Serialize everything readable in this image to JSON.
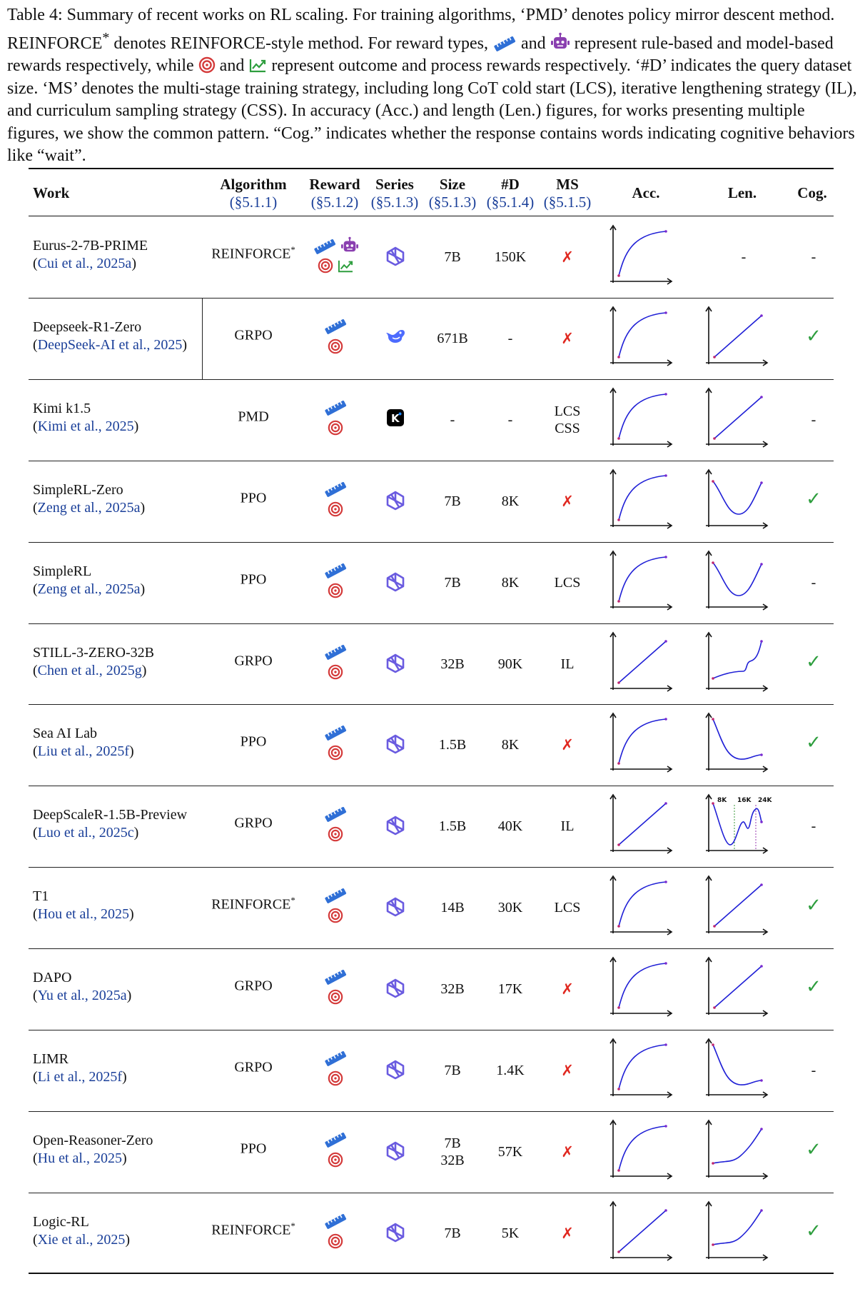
{
  "caption": {
    "p1": "Table 4: Summary of recent works on RL scaling. For training algorithms, ‘PMD’ denotes policy mirror descent method. REINFORCE",
    "p1_sup": "*",
    "p2": " denotes REINFORCE-style method. For reward types,",
    "p3": " and ",
    "p4": " represent rule-based and model-based rewards respectively, while ",
    "p5": " and ",
    "p6": " represent outcome and process rewards respectively. ‘#D’ indicates the query dataset size. ‘MS’ denotes the multi-stage training strategy, including long CoT cold start (LCS), iterative lengthening strategy (IL), and curriculum sampling strategy (CSS). In accuracy (Acc.) and length (Len.) figures, for works presenting multiple figures, we show the common pattern. “Cog.” indicates whether the response contains words indicating cognitive behaviors like “wait”."
  },
  "headers": {
    "work": "Work",
    "algorithm": "Algorithm",
    "algorithm_sec": "(§5.1.1)",
    "reward": "Reward",
    "reward_sec": "(§5.1.2)",
    "series": "Series",
    "series_sec": "(§5.1.3)",
    "size": "Size",
    "size_sec": "(§5.1.3)",
    "dataset": "#D",
    "dataset_sec": "(§5.1.4)",
    "ms": "MS",
    "ms_sec": "(§5.1.5)",
    "acc": "Acc.",
    "len": "Len.",
    "cog": "Cog."
  },
  "rows": [
    {
      "name": "Eurus-2-7B-PRIME",
      "cite": "Cui et al., 2025a",
      "algo": "REINFORCE",
      "algo_sup": "*",
      "reward": "rule+model+outcome+process",
      "series": "qwen-icon",
      "size": "7B",
      "d": "150K",
      "ms": "✗",
      "acc": "concave",
      "len": "-",
      "cog": "-"
    },
    {
      "name": "Deepseek-R1-Zero",
      "cite": "DeepSeek-AI et al., 2025",
      "algo": "GRPO",
      "algo_sup": "",
      "reward": "rule+outcome",
      "series": "deepseek-icon",
      "size": "671B",
      "d": "-",
      "ms": "✗",
      "acc": "concave",
      "len": "linear",
      "cog": "✓"
    },
    {
      "name": "Kimi k1.5",
      "cite": "Kimi et al., 2025",
      "algo": "PMD",
      "algo_sup": "",
      "reward": "rule+outcome",
      "series": "kimi-icon",
      "size": "-",
      "d": "-",
      "ms": "LCS\nCSS",
      "acc": "concave",
      "len": "linear",
      "cog": "-"
    },
    {
      "name": "SimpleRL-Zero",
      "cite": "Zeng et al., 2025a",
      "algo": "PPO",
      "algo_sup": "",
      "reward": "rule+outcome",
      "series": "qwen-icon",
      "size": "7B",
      "d": "8K",
      "ms": "✗",
      "acc": "concave",
      "len": "valley",
      "cog": "✓"
    },
    {
      "name": "SimpleRL",
      "cite": "Zeng et al., 2025a",
      "algo": "PPO",
      "algo_sup": "",
      "reward": "rule+outcome",
      "series": "qwen-icon",
      "size": "7B",
      "d": "8K",
      "ms": "LCS",
      "acc": "concave",
      "len": "valley",
      "cog": "-"
    },
    {
      "name": "STILL-3-ZERO-32B",
      "cite": "Chen et al., 2025g",
      "algo": "GRPO",
      "algo_sup": "",
      "reward": "rule+outcome",
      "series": "qwen-icon",
      "size": "32B",
      "d": "90K",
      "ms": "IL",
      "acc": "linear",
      "len": "bumpup",
      "cog": "✓"
    },
    {
      "name": "Sea AI Lab",
      "cite": "Liu et al., 2025f",
      "algo": "PPO",
      "algo_sup": "",
      "reward": "rule+outcome",
      "series": "qwen-icon",
      "size": "1.5B",
      "d": "8K",
      "ms": "✗",
      "acc": "concave",
      "len": "decay",
      "cog": "✓"
    },
    {
      "name": "DeepScaleR-1.5B-Preview",
      "cite": "Luo et al., 2025c",
      "algo": "GRPO",
      "algo_sup": "",
      "reward": "rule+outcome",
      "series": "qwen-icon",
      "size": "1.5B",
      "d": "40K",
      "ms": "IL",
      "acc": "linear",
      "len": "stages",
      "cog": "-"
    },
    {
      "name": "T1",
      "cite": "Hou et al., 2025",
      "algo": "REINFORCE",
      "algo_sup": "*",
      "reward": "rule+outcome",
      "series": "qwen-icon",
      "size": "14B",
      "d": "30K",
      "ms": "LCS",
      "acc": "concave",
      "len": "linear",
      "cog": "✓"
    },
    {
      "name": "DAPO",
      "cite": "Yu et al., 2025a",
      "algo": "GRPO",
      "algo_sup": "",
      "reward": "rule+outcome",
      "series": "qwen-icon",
      "size": "32B",
      "d": "17K",
      "ms": "✗",
      "acc": "concave",
      "len": "linear",
      "cog": "✓"
    },
    {
      "name": "LIMR",
      "cite": "Li et al., 2025f",
      "algo": "GRPO",
      "algo_sup": "",
      "reward": "rule+outcome",
      "series": "qwen-icon",
      "size": "7B",
      "d": "1.4K",
      "ms": "✗",
      "acc": "concave",
      "len": "decay",
      "cog": "-"
    },
    {
      "name": "Open-Reasoner-Zero",
      "cite": "Hu et al., 2025",
      "algo": "PPO",
      "algo_sup": "",
      "reward": "rule+outcome",
      "series": "qwen-icon",
      "size": "7B\n32B",
      "d": "57K",
      "ms": "✗",
      "acc": "concave",
      "len": "convex",
      "cog": "✓"
    },
    {
      "name": "Logic-RL",
      "cite": "Xie et al., 2025",
      "algo": "REINFORCE",
      "algo_sup": "*",
      "reward": "rule+outcome",
      "series": "qwen-icon",
      "size": "7B",
      "d": "5K",
      "ms": "✗",
      "acc": "linear",
      "len": "convex",
      "cog": "✓"
    }
  ],
  "stage_labels": [
    "8K",
    "16K",
    "24K"
  ],
  "colors": {
    "cite": "#1a3f99",
    "curve": "#1f1fd6",
    "xmark": "#e0271f",
    "check": "#2e9e3e",
    "rule_icon": "#2f6fd6",
    "model_icon": "#8a3fb0",
    "outcome_icon": "#d43a3a",
    "process_icon": "#2e9e3e"
  }
}
